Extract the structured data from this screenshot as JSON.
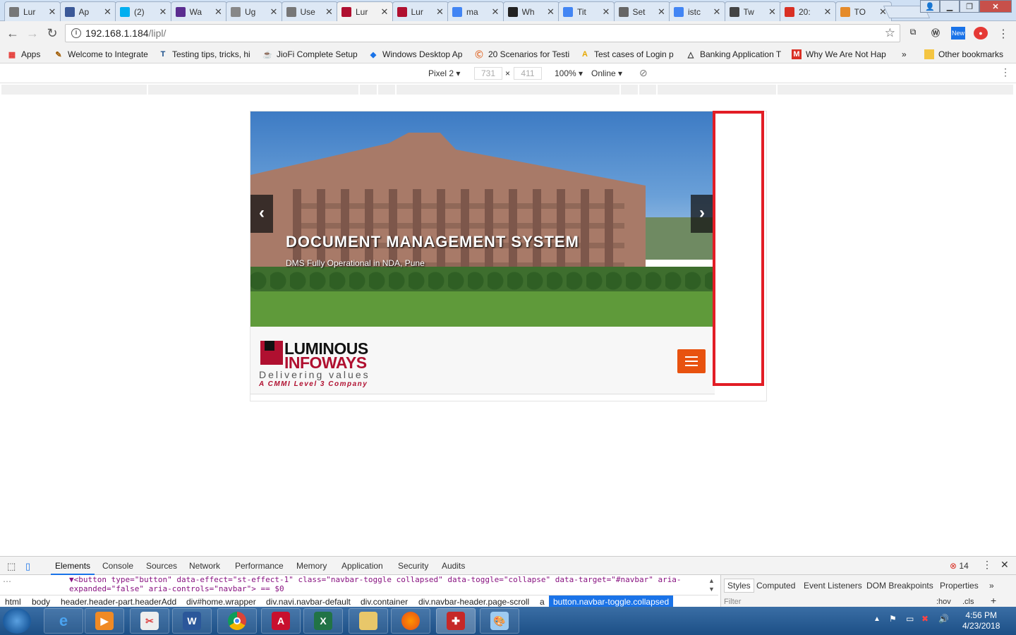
{
  "browser": {
    "tabs": [
      {
        "label": "Lur",
        "favicon": "page-icon",
        "color": "#777777"
      },
      {
        "label": "Ap",
        "favicon": "ox-icon",
        "color": "#3b5998"
      },
      {
        "label": "(2)",
        "favicon": "skype-icon",
        "color": "#00aff0"
      },
      {
        "label": "Wa",
        "favicon": "hexagon-icon",
        "color": "#5b2d90"
      },
      {
        "label": "Ug",
        "favicon": "globe-icon",
        "color": "#888888"
      },
      {
        "label": "Use",
        "favicon": "page-icon",
        "color": "#777777"
      },
      {
        "label": "Lur",
        "favicon": "luminous-icon",
        "color": "#b01030"
      },
      {
        "label": "Lur",
        "favicon": "luminous-icon",
        "color": "#b01030"
      },
      {
        "label": "ma",
        "favicon": "google-icon",
        "color": "#4285f4"
      },
      {
        "label": "Wh",
        "favicon": "dn-icon",
        "color": "#222222"
      },
      {
        "label": "Tit",
        "favicon": "google-icon",
        "color": "#4285f4"
      },
      {
        "label": "Set",
        "favicon": "gear-icon",
        "color": "#666666"
      },
      {
        "label": "istc",
        "favicon": "google-icon",
        "color": "#4285f4"
      },
      {
        "label": "Tw",
        "favicon": "tw-icon",
        "color": "#444444"
      },
      {
        "label": "20:",
        "favicon": "pdf-icon",
        "color": "#d93025"
      },
      {
        "label": "TO",
        "favicon": "cone-icon",
        "color": "#e58b2a"
      }
    ],
    "active_tab_index": 6,
    "url_host": "192.168.1.184",
    "url_path": "/lipl/",
    "bookmarks": [
      {
        "label": "Apps",
        "icon": "apps-grid-icon"
      },
      {
        "label": "Welcome to Integrate",
        "icon": "feather-icon"
      },
      {
        "label": "Testing tips, tricks, hi",
        "icon": "t-letter-icon"
      },
      {
        "label": "JioFi Complete Setup",
        "icon": "jiofi-icon"
      },
      {
        "label": "Windows Desktop Ap",
        "icon": "diamond-icon"
      },
      {
        "label": "20 Scenarios for Testi",
        "icon": "c-circle-icon"
      },
      {
        "label": "Test cases of Login p",
        "icon": "a-letter-icon"
      },
      {
        "label": "Banking Application T",
        "icon": "triangle-icon"
      },
      {
        "label": "Why We Are Not Hap",
        "icon": "m-letter-icon"
      },
      {
        "label": "»",
        "icon": ""
      },
      {
        "label": "Other bookmarks",
        "icon": "folder-icon"
      }
    ]
  },
  "device_toolbar": {
    "device": "Pixel 2",
    "width": "731",
    "x": "×",
    "height": "411",
    "zoom": "100%",
    "network": "Online"
  },
  "page": {
    "hero_title": "DOCUMENT MANAGEMENT SYSTEM",
    "hero_subtitle": "DMS Fully Operational in NDA, Pune",
    "logo_line1": "LUMINOUS",
    "logo_line2": "INFOWAYS",
    "logo_tagline": "Delivering values",
    "logo_subtag": "A CMMI Level 3 Company",
    "prev_arrow": "‹",
    "next_arrow": "›"
  },
  "devtools": {
    "tabs": [
      "Elements",
      "Console",
      "Sources",
      "Network",
      "Performance",
      "Memory",
      "Application",
      "Security",
      "Audits"
    ],
    "active_tab": "Elements",
    "error_count": "14",
    "code_line1": "▼<button type=\"button\" data-effect=\"st-effect-1\" class=\"navbar-toggle collapsed\" data-toggle=\"collapse\" data-target=\"#navbar\" aria-",
    "code_line2": "expanded=\"false\" aria-controls=\"navbar\"> == $0",
    "breadcrumbs": [
      "html",
      "body",
      "header.header-part.headerAdd",
      "div#home.wrapper",
      "div.navi.navbar-default",
      "div.container",
      "div.navbar-header.page-scroll",
      "a",
      "button.navbar-toggle.collapsed"
    ],
    "side_tabs": [
      "Styles",
      "Computed",
      "Event Listeners",
      "DOM Breakpoints",
      "Properties"
    ],
    "filter_placeholder": "Filter",
    "hov": ":hov",
    "cls": ".cls",
    "plus": "+"
  },
  "taskbar": {
    "time": "4:56 PM",
    "date": "4/23/2018"
  }
}
